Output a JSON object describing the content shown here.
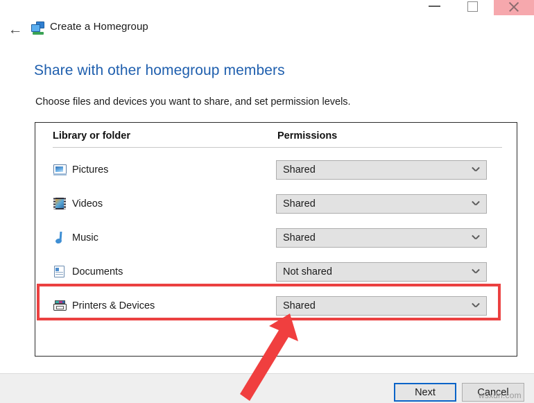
{
  "window": {
    "minimize_label": "Minimize",
    "maximize_label": "Maximize",
    "close_label": "Close",
    "accent_close_bg": "#f6a8ad"
  },
  "nav": {
    "back_label": "←",
    "title": "Create a Homegroup",
    "icon": "homegroup-icon"
  },
  "page": {
    "heading": "Share with other homegroup members",
    "subheading": "Choose files and devices you want to share, and set permission levels.",
    "heading_color": "#1f5fae"
  },
  "table": {
    "columns": [
      "Library or folder",
      "Permissions"
    ],
    "rows": [
      {
        "icon": "pictures-icon",
        "label": "Pictures",
        "permission": "Shared"
      },
      {
        "icon": "videos-icon",
        "label": "Videos",
        "permission": "Shared"
      },
      {
        "icon": "music-icon",
        "label": "Music",
        "permission": "Shared"
      },
      {
        "icon": "documents-icon",
        "label": "Documents",
        "permission": "Not shared"
      },
      {
        "icon": "printer-icon",
        "label": "Printers & Devices",
        "permission": "Shared"
      }
    ],
    "permission_options": [
      "Shared",
      "Not shared"
    ]
  },
  "footer": {
    "next_label": "Next",
    "cancel_label": "Cancel"
  },
  "annotations": {
    "highlight_color": "#eb4141",
    "arrow_color": "#f03f3f",
    "highlighted_row": "Printers & Devices",
    "watermark": "wsxdn.com"
  }
}
